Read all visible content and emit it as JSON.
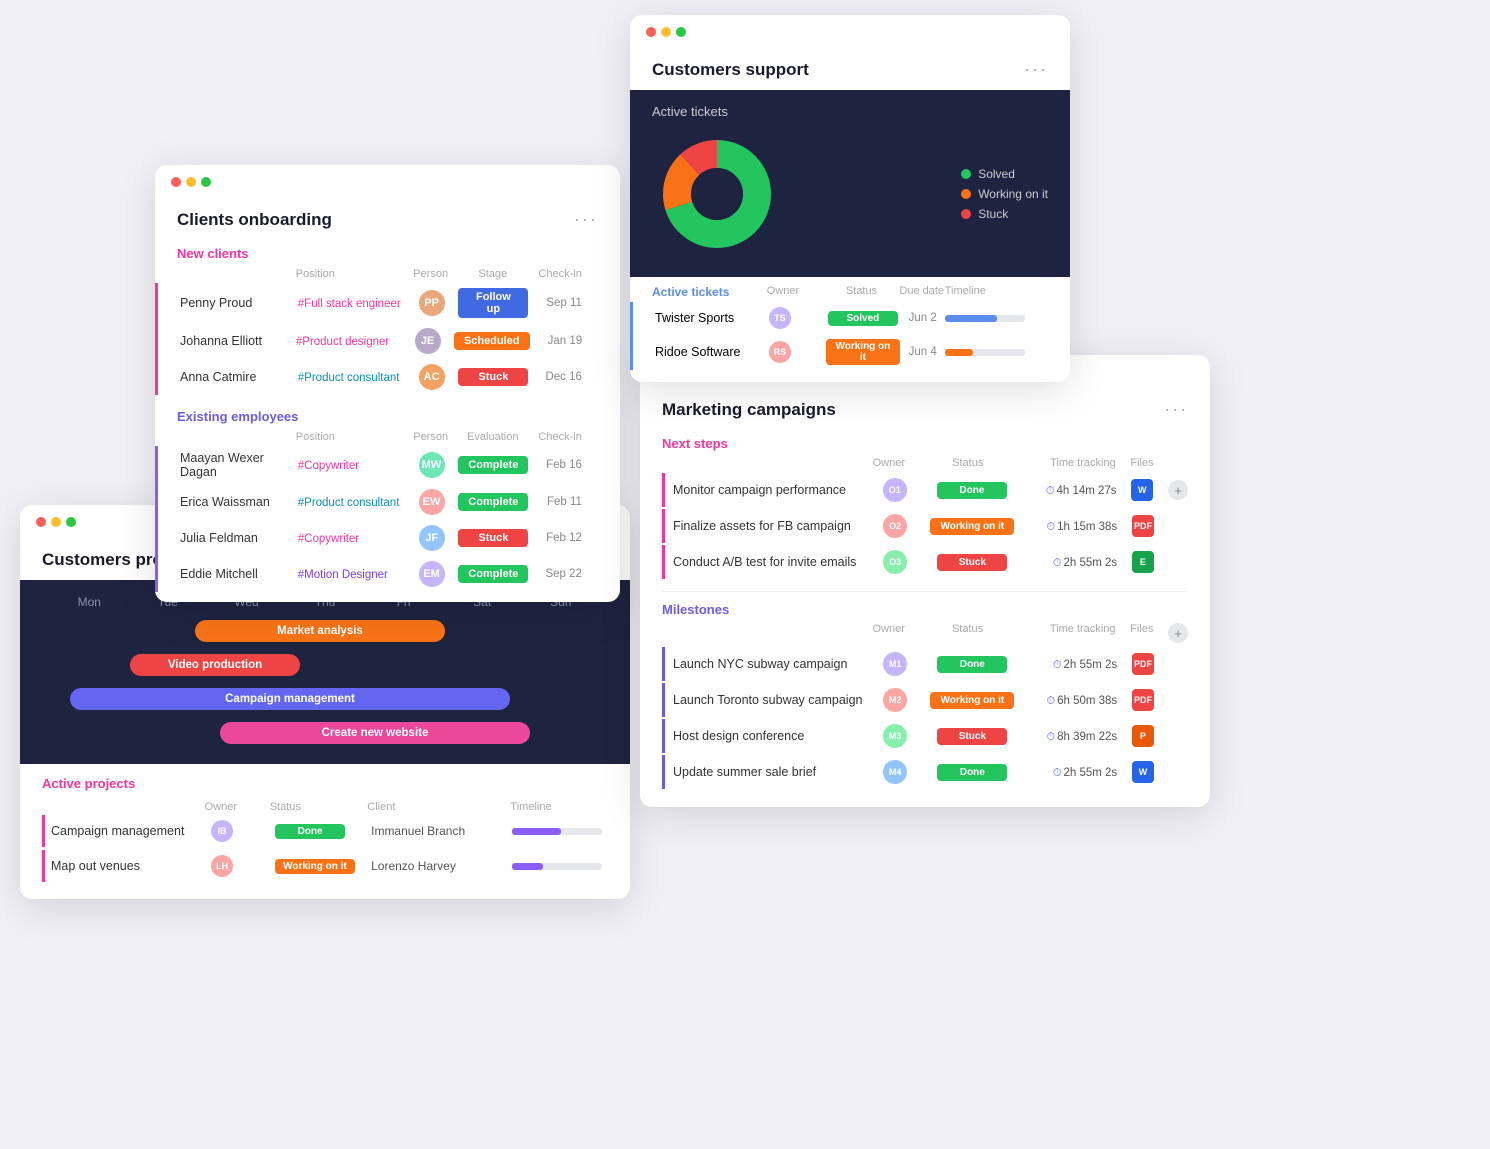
{
  "clients": {
    "title": "Clients onboarding",
    "new_clients_label": "New clients",
    "existing_employees_label": "Existing employees",
    "headers": {
      "name": "",
      "position": "Position",
      "person": "Person",
      "stage": "Stage",
      "checkin": "Check-in"
    },
    "eval_header": "Evaluation",
    "new_clients": [
      {
        "name": "Penny Proud",
        "position": "#Full stack engineer",
        "position_color": "pink",
        "stage": "Follow up",
        "stage_color": "blue",
        "checkin": "Sep 11"
      },
      {
        "name": "Johanna Elliott",
        "position": "#Product designer",
        "position_color": "pink",
        "stage": "Scheduled",
        "stage_color": "orange",
        "checkin": "Jan 19"
      },
      {
        "name": "Anna Catmire",
        "position": "#Product consultant",
        "position_color": "teal",
        "stage": "Stuck",
        "stage_color": "red",
        "checkin": "Dec 16"
      }
    ],
    "existing_employees": [
      {
        "name": "Maayan Wexer Dagan",
        "position": "#Copywriter",
        "position_color": "pink",
        "eval": "Complete",
        "eval_color": "green",
        "checkin": "Feb 16"
      },
      {
        "name": "Erica Waissman",
        "position": "#Product consultant",
        "position_color": "teal",
        "eval": "Complete",
        "eval_color": "green",
        "checkin": "Feb 11"
      },
      {
        "name": "Julia Feldman",
        "position": "#Copywriter",
        "position_color": "pink",
        "eval": "Stuck",
        "eval_color": "red",
        "checkin": "Feb 12"
      },
      {
        "name": "Eddie Mitchell",
        "position": "#Motion Designer",
        "position_color": "purple",
        "eval": "Complete",
        "eval_color": "green",
        "checkin": "Sep 22"
      }
    ]
  },
  "support": {
    "title": "Customers support",
    "active_tickets_label": "Active tickets",
    "legend": [
      {
        "label": "Solved",
        "color": "#22c55e"
      },
      {
        "label": "Working on it",
        "color": "#f97316"
      },
      {
        "label": "Stuck",
        "color": "#ef4444"
      }
    ],
    "tickets_section_label": "Active tickets",
    "headers": {
      "client": "",
      "owner": "Owner",
      "status": "Status",
      "due": "Due date",
      "timeline": "Timeline"
    },
    "rows": [
      {
        "client": "Twister Sports",
        "status": "Solved",
        "status_color": "green",
        "due": "Jun 2",
        "timeline_pct": 65
      },
      {
        "client": "Ridoe Software",
        "status": "Working on it",
        "status_color": "orange",
        "due": "Jun 4",
        "timeline_pct": 35
      }
    ]
  },
  "projects": {
    "title": "Customers projects",
    "gantt_days": [
      "Mon",
      "Tue",
      "Wed",
      "Thu",
      "Fri",
      "Sat",
      "Sun"
    ],
    "gantt_bars": [
      {
        "label": "Market analysis",
        "color": "orange",
        "left_pct": 25,
        "width_pct": 45
      },
      {
        "label": "Video production",
        "color": "coral",
        "left_pct": 18,
        "width_pct": 30
      },
      {
        "label": "Campaign management",
        "color": "blue-g",
        "left_pct": 10,
        "width_pct": 75
      },
      {
        "label": "Create new website",
        "color": "pink-g",
        "left_pct": 30,
        "width_pct": 55
      }
    ],
    "active_projects_label": "Active projects",
    "active_headers": {
      "name": "",
      "owner": "Owner",
      "status": "Status",
      "client": "Client",
      "timeline": "Timeline"
    },
    "active_rows": [
      {
        "name": "Campaign management",
        "status": "Done",
        "status_color": "green",
        "client": "Immanuel Branch"
      },
      {
        "name": "Map out venues",
        "status": "Working on it",
        "status_color": "orange",
        "client": "Lorenzo Harvey"
      }
    ]
  },
  "marketing": {
    "title": "Marketing campaigns",
    "next_steps_label": "Next steps",
    "milestones_label": "Milestones",
    "headers": {
      "name": "",
      "owner": "Owner",
      "status": "Status",
      "time": "Time tracking",
      "files": "Files"
    },
    "next_steps": [
      {
        "name": "Monitor campaign performance",
        "status": "Done",
        "status_color": "green",
        "time": "4h 14m 27s",
        "file_type": "word"
      },
      {
        "name": "Finalize assets for FB campaign",
        "status": "Working on it",
        "status_color": "orange",
        "time": "1h 15m 38s",
        "file_type": "pdf"
      },
      {
        "name": "Conduct A/B test for invite emails",
        "status": "Stuck",
        "status_color": "red",
        "time": "2h 55m 2s",
        "file_type": "sheets"
      }
    ],
    "milestones": [
      {
        "name": "Launch NYC subway campaign",
        "status": "Done",
        "status_color": "green",
        "time": "2h 55m 2s",
        "file_type": "pdf"
      },
      {
        "name": "Launch Toronto subway campaign",
        "status": "Working on it",
        "status_color": "orange",
        "time": "6h 50m 38s",
        "file_type": "pdf"
      },
      {
        "name": "Host design conference",
        "status": "Stuck",
        "status_color": "red",
        "time": "8h 39m 22s",
        "file_type": "ppt"
      },
      {
        "name": "Update summer sale brief",
        "status": "Done",
        "status_color": "green",
        "time": "2h 55m 2s",
        "file_type": "word"
      }
    ]
  }
}
